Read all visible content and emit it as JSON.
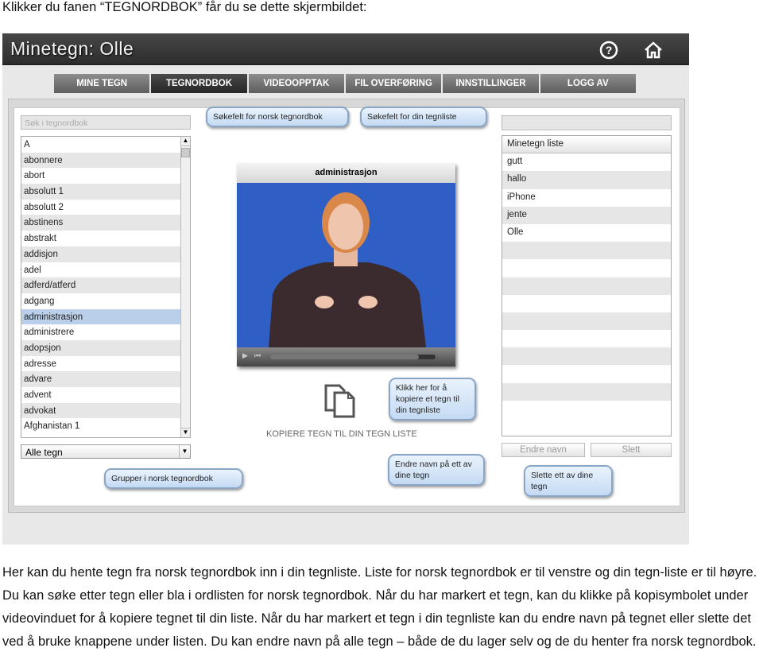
{
  "caption": "Klikker du fanen “TEGNORDBOK” får du se dette skjermbildet:",
  "app": {
    "title": "Minetegn: Olle",
    "help_icon": "question-circle-icon",
    "home_icon": "home-icon"
  },
  "nav": [
    {
      "label": "MINE TEGN"
    },
    {
      "label": "TEGNORDBOK",
      "active": true
    },
    {
      "label": "VIDEOOPPTAK"
    },
    {
      "label": "FIL OVERFØRING"
    },
    {
      "label": "INNSTILLINGER"
    },
    {
      "label": "LOGG AV"
    }
  ],
  "left": {
    "search_placeholder": "Søk i tegnordbok",
    "items": [
      "A",
      "abonnere",
      "abort",
      "absolutt 1",
      "absolutt 2",
      "abstinens",
      "abstrakt",
      "addisjon",
      "adel",
      "adferd/atferd",
      "adgang",
      "administrasjon",
      "administrere",
      "adopsjon",
      "adresse",
      "advare",
      "advent",
      "advokat",
      "Afghanistan 1"
    ],
    "selected": "administrasjon",
    "group_select": "Alle tegn"
  },
  "video": {
    "title": "administrasjon",
    "progress": 0.9,
    "background": "#2f5fc4"
  },
  "copy": {
    "label": "KOPIERE TEGN TIL DIN TEGN LISTE"
  },
  "right": {
    "header": "Minetegn liste",
    "items": [
      "gutt",
      "hallo",
      "iPhone",
      "jente",
      "Olle"
    ],
    "rename_button": "Endre navn",
    "delete_button": "Slett"
  },
  "callouts": {
    "search_dict": "Søkefelt for norsk tegnordbok",
    "search_list": "Søkefelt for din tegnliste",
    "copy": "Klikk her for å kopiere et tegn til din tegnliste",
    "rename": "Endre navn på ett av dine tegn",
    "delete": "Slette ett av dine tegn",
    "group": "Grupper i norsk tegnordbok"
  },
  "paragraph": "Her kan du hente tegn fra norsk tegnordbok inn i din tegnliste. Liste for norsk tegnordbok er til venstre og din tegn-liste er til høyre. Du kan søke etter tegn eller bla i ordlisten for norsk tegnordbok. Når du har markert et tegn, kan du klikke på kopisymbolet under videovinduet for å kopiere tegnet til din liste. Når du har markert et tegn i din tegnliste kan du endre navn på tegnet eller slette det ved å bruke knappene under listen. Du kan endre navn på alle tegn – både de du lager selv og de du henter fra norsk tegnordbok."
}
